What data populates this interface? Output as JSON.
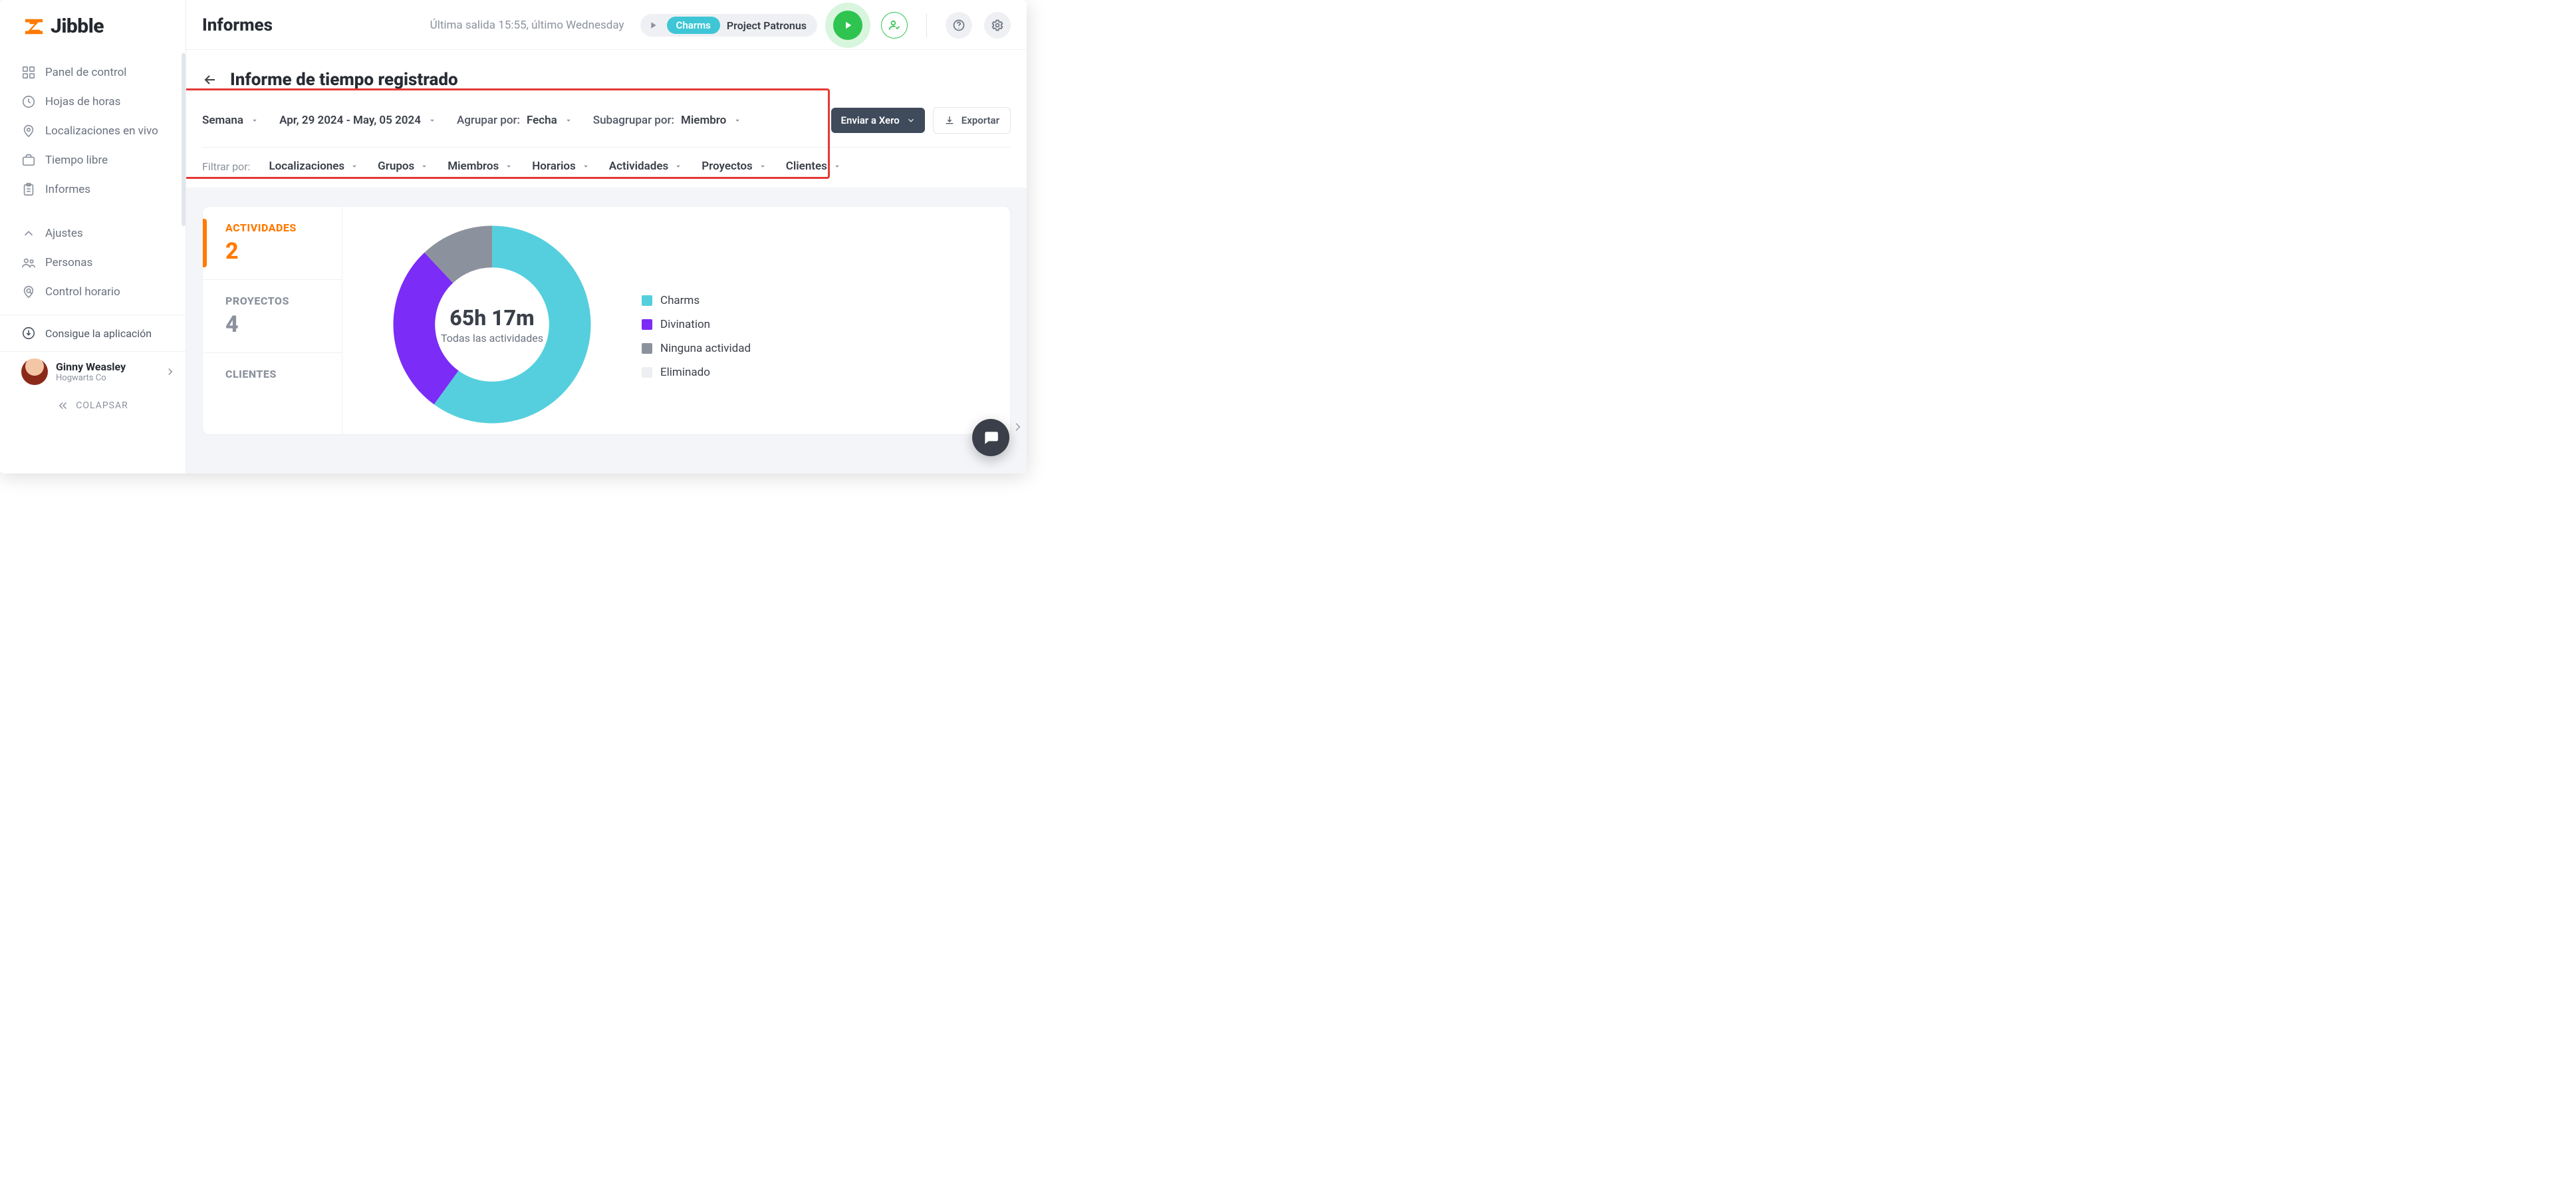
{
  "brand": {
    "name": "Jibble"
  },
  "sidebar": {
    "items": [
      {
        "label": "Panel de control"
      },
      {
        "label": "Hojas de horas"
      },
      {
        "label": "Localizaciones en vivo"
      },
      {
        "label": "Tiempo libre"
      },
      {
        "label": "Informes"
      },
      {
        "label": "Ajustes"
      },
      {
        "label": "Personas"
      },
      {
        "label": "Control horario"
      }
    ],
    "get_app": "Consigue la aplicación",
    "collapse": "COLAPSAR",
    "user": {
      "name": "Ginny Weasley",
      "org": "Hogwarts Co"
    }
  },
  "topbar": {
    "page": "Informes",
    "last_entry": "Última salida 15:55, último Wednesday",
    "chip": "Charms",
    "project": "Project Patronus"
  },
  "subheader": {
    "title": "Informe de tiempo registrado"
  },
  "toolbar": {
    "range_mode": "Semana",
    "range_value": "Apr, 29 2024 - May, 05 2024",
    "group_by_label": "Agrupar por:",
    "group_by_value": "Fecha",
    "subgroup_by_label": "Subagrupar por:",
    "subgroup_by_value": "Miembro",
    "send_xero": "Enviar a Xero",
    "export": "Exportar"
  },
  "filters": {
    "label": "Filtrar por:",
    "items": [
      "Localizaciones",
      "Grupos",
      "Miembros",
      "Horarios",
      "Actividades",
      "Proyectos",
      "Clientes"
    ]
  },
  "report": {
    "tabs": [
      {
        "title": "ACTIVIDADES",
        "count": "2"
      },
      {
        "title": "PROYECTOS",
        "count": "4"
      },
      {
        "title": "CLIENTES",
        "count": ""
      }
    ],
    "donut": {
      "total_label": "65h 17m",
      "sub_label": "Todas las actividades"
    },
    "legend": [
      {
        "label": "Charms",
        "color": "#55CFDD"
      },
      {
        "label": "Divination",
        "color": "#7B2CF6"
      },
      {
        "label": "Ninguna actividad",
        "color": "#8C929D"
      },
      {
        "label": "Eliminado",
        "color": "#ECEEF1"
      }
    ]
  },
  "chart_data": {
    "type": "pie",
    "title": "Todas las actividades",
    "total_label": "65h 17m",
    "series": [
      {
        "name": "Charms",
        "value": 60,
        "color": "#55CFDD"
      },
      {
        "name": "Divination",
        "value": 28,
        "color": "#7B2CF6"
      },
      {
        "name": "Ninguna actividad",
        "value": 12,
        "color": "#8C929D"
      },
      {
        "name": "Eliminado",
        "value": 0,
        "color": "#ECEEF1"
      }
    ]
  }
}
